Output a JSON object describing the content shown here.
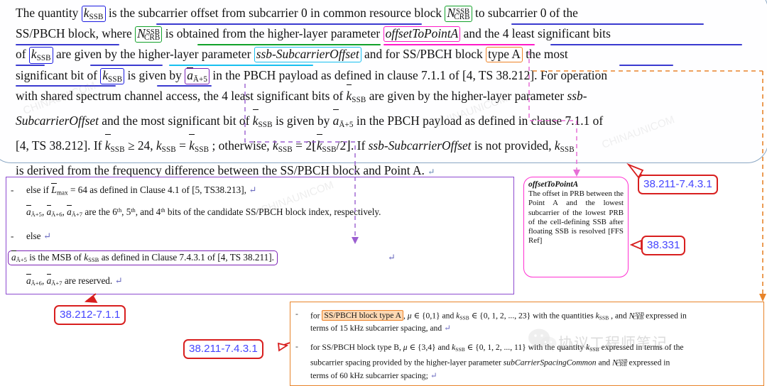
{
  "document": {
    "top_paragraph": {
      "line1_a": "The quantity ",
      "token_kssb_1": "k",
      "token_kssb_sub": "SSB",
      "line1_b": " is the subcarrier offset from subcarrier 0 in common resource block ",
      "token_ncrb_n": "N",
      "token_ncrb_sub": "CRB",
      "token_ncrb_sup": "SSB",
      "line1_c": " to subcarrier 0 of the",
      "line2_a": "SS/PBCH block, where ",
      "line2_b": " is obtained from the higher-layer parameter ",
      "token_offsetToPointA": "offsetToPointA",
      "line2_c": " and the 4 least significant bits",
      "line3_a": "of ",
      "line3_b": " are given by the higher-layer parameter ",
      "token_ssbSubcarrierOffset": "ssb-SubcarrierOffset",
      "line3_c": " and for SS/PBCH block ",
      "token_typeA": "type A",
      "line3_d": " the most",
      "line4_a": "significant bit of ",
      "line4_b": " is given by ",
      "token_abar": "a",
      "token_abar_sub": "Ā+5",
      "line4_c": " in the PBCH payload as defined in clause 7.1.1 of [4, TS 38.212]. For operation",
      "line5": "with shared spectrum channel access, the 4 least significant bits of k̄SSB are given by the higher-layer parameter ssb-",
      "line6": "SubcarrierOffset and the most significant bit of k̄SSB is given by āĀ+5 in the PBCH payload as defined in clause 7.1.1 of",
      "line7": "[4, TS 38.212]. If k̄SSB ≥ 24, kSSB = k̄SSB ; otherwise, kSSB = 2⌊k̄SSB/2⌋. If ssb-SubcarrierOffset is not provided, kSSB",
      "line8": "is derived from the frequency difference between the SS/PBCH block and Point A."
    },
    "purple_panel": {
      "bullet1_dash": "-",
      "bullet1_text_a": "else if ",
      "bullet1_lmax": "L",
      "bullet1_lmax_sub": "max",
      "bullet1_text_b": " = 64 as defined in Clause 4.1 of [5, TS38.213],",
      "line2": "āĀ+5, āĀ+6, āĀ+7 are the 6th, 5th, and 4th bits of the candidate SS/PBCH block index, respectively.",
      "bullet2_dash": "-",
      "bullet2_text": "else",
      "msb_box": "āĀ+5 is the MSB of kSSB as defined in Clause 7.4.3.1 of [4, TS 38.211].",
      "line_reserved": "āĀ+6, āĀ+7 are reserved."
    },
    "magenta_callout": {
      "title": "offsetToPointA",
      "body": "The offset in PRB between the Point A and the lowest subcarrier of the lowest PRB of the cell-defining SSB after floating SSB is resolved [FFS Ref]"
    },
    "orange_panel": {
      "bullet1_dash": "-",
      "bullet1_pre": "for ",
      "bullet1_highlight": "SS/PBCH block type A",
      "bullet1_post": ", μ ∈ {0,1} and kSSB ∈ {0, 1, 2, ..., 23} with the quantities kSSB , and NCRB^SSB expressed in",
      "bullet1_cont": "terms of 15 kHz subcarrier spacing, and",
      "bullet2_dash": "-",
      "bullet2_line1": "for SS/PBCH block type B, μ ∈ {3,4} and kSSB ∈ {0, 1, 2, ..., 11} with the quantity kSSB expressed in terms of the",
      "bullet2_line2": "subcarrier spacing provided by the higher-layer parameter subCarrierSpacingCommon and NCRB^SSB expressed in",
      "bullet2_line3": "terms of 60 kHz subcarrier spacing;"
    },
    "reference_tags": {
      "tag_top_right": "38.211-7.4.3.1",
      "tag_mid_right": "38.331",
      "tag_bottom_left": "38.212-7.1.1",
      "tag_bottom_mid": "38.211-7.4.3.1"
    },
    "watermark": {
      "chinese_text": "协议工程师笔记",
      "ghost_text": "CHINAUNICOM"
    }
  },
  "colors": {
    "box_blue": "#1a1ae0",
    "box_green": "#12a12a",
    "box_magenta": "#ff19c8",
    "box_cyan": "#17bff0",
    "box_orange": "#ef8327",
    "box_purple": "#7b21b5",
    "underline_blue": "#3a3ad0",
    "underline_green": "#12a12a",
    "underline_magenta": "#ff19c8",
    "underline_cyan": "#17bff0",
    "tag_border_red": "#d81f1f",
    "tag_text_blue": "#4646ff",
    "panel_top_border": "#8aa7c4",
    "panel_purple_border": "#8d4ad0",
    "panel_orange_border": "#e8842a",
    "connector_magenta": "#e040c8",
    "connector_orange": "#e8842a"
  }
}
